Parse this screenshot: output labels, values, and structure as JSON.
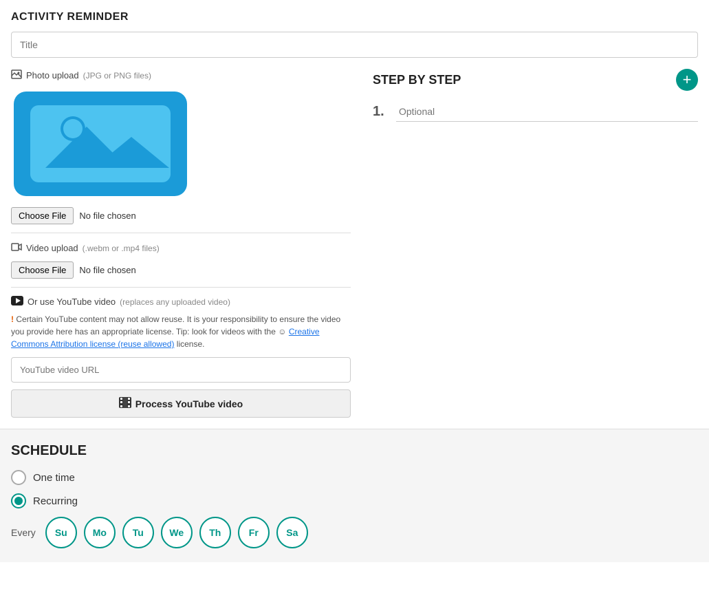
{
  "page": {
    "title": "ACTIVITY REMINDER"
  },
  "title_input": {
    "placeholder": "Title",
    "value": ""
  },
  "photo_upload": {
    "label": "Photo upload",
    "sublabel": "(JPG or PNG files)",
    "choose_file_label": "Choose File",
    "no_file_label": "No file chosen"
  },
  "video_upload": {
    "label": "Video upload",
    "sublabel": "(.webm or .mp4 files)",
    "choose_file_label": "Choose File",
    "no_file_label": "No file chosen"
  },
  "youtube": {
    "label": "Or use YouTube video",
    "sublabel": "(replaces any uploaded video)",
    "warning": "Certain YouTube content may not allow reuse. It is your responsibility to ensure the video you provide here has an appropriate license. Tip: look for videos with the",
    "warning_link": "Creative Commons Attribution license (reuse allowed)",
    "warning_end": "license.",
    "url_placeholder": "YouTube video URL",
    "process_btn_label": "Process YouTube video"
  },
  "step_by_step": {
    "title": "STEP BY STEP",
    "add_icon": "+",
    "steps": [
      {
        "number": "1.",
        "placeholder": "Optional"
      }
    ]
  },
  "schedule": {
    "title": "SCHEDULE",
    "options": [
      {
        "label": "One time",
        "selected": false
      },
      {
        "label": "Recurring",
        "selected": true
      }
    ],
    "every_label": "Every",
    "days": [
      {
        "label": "Su",
        "selected": true
      },
      {
        "label": "Mo",
        "selected": true
      },
      {
        "label": "Tu",
        "selected": true
      },
      {
        "label": "We",
        "selected": true
      },
      {
        "label": "Th",
        "selected": true
      },
      {
        "label": "Fr",
        "selected": true
      },
      {
        "label": "Sa",
        "selected": true
      }
    ]
  }
}
